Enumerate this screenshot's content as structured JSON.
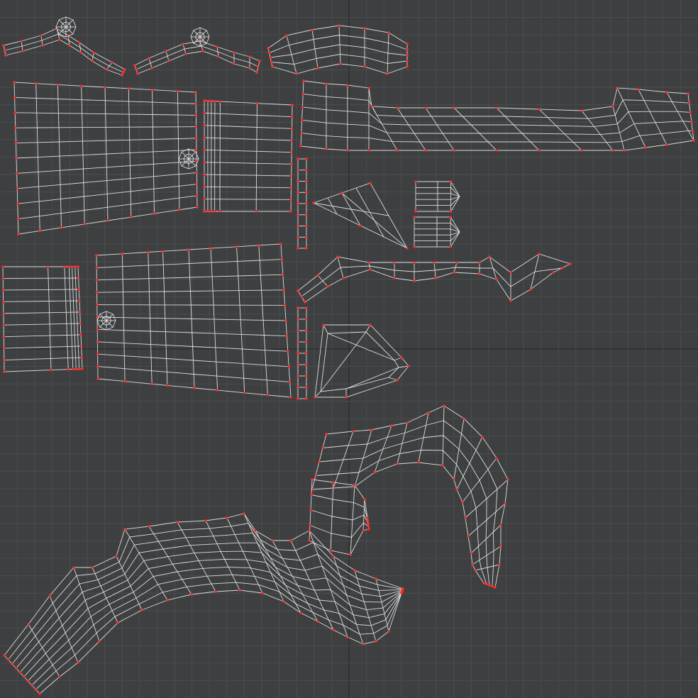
{
  "editor": {
    "view": "uv-layout",
    "grid_divisions": 20,
    "grid_subdivisions": 2,
    "shell_count": 16
  },
  "colors": {
    "background": "#3d3f41",
    "grid_minor": "#4a4c4f",
    "grid_major": "#2a2b2d",
    "wire": "#dcdcdc",
    "seam_vertex": "#ff2a2a"
  }
}
